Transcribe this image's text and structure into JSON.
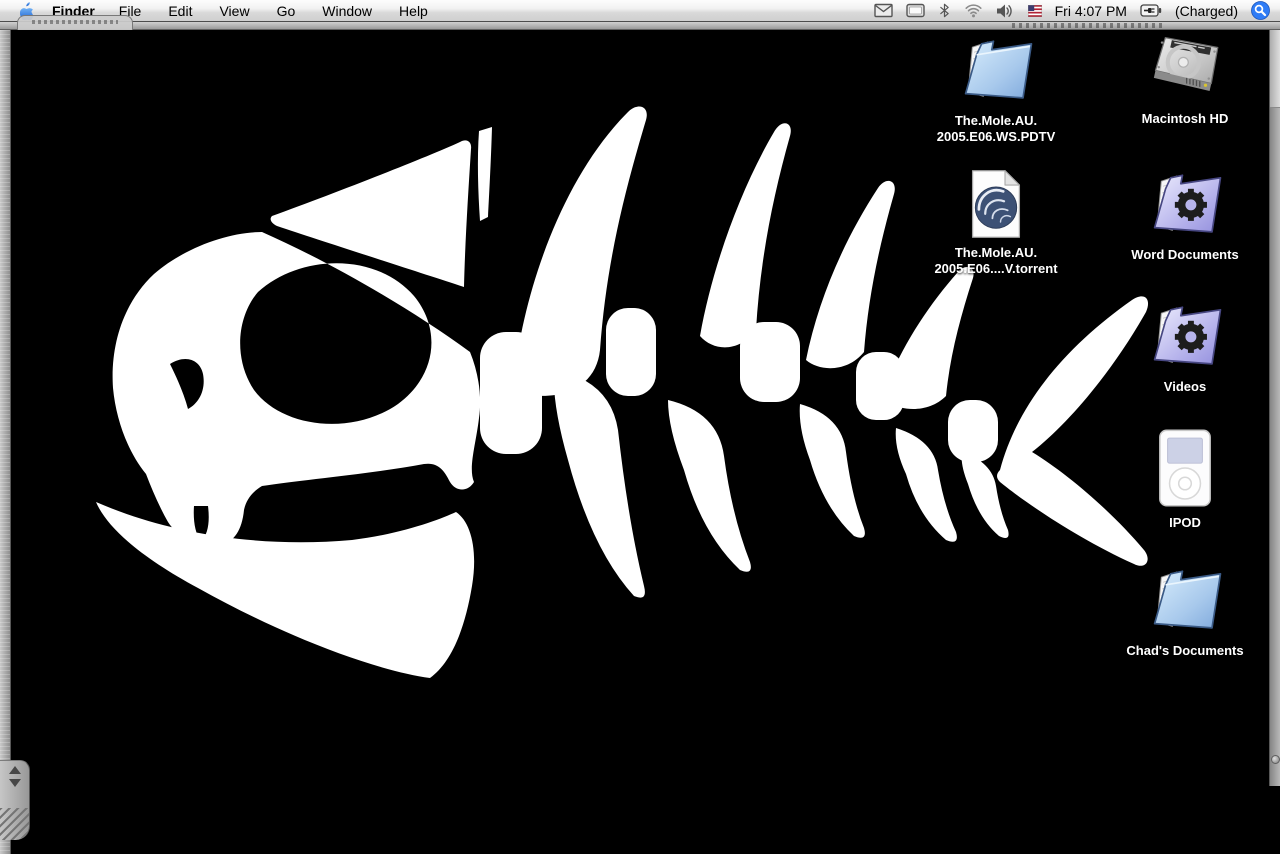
{
  "menu_bar": {
    "app_name": "Finder",
    "menus": [
      "File",
      "Edit",
      "View",
      "Go",
      "Window",
      "Help"
    ],
    "clock": "Fri 4:07 PM",
    "battery_status": "(Charged)",
    "status_icons": [
      "mail-icon",
      "display-icon",
      "bluetooth-icon",
      "wifi-icon",
      "volume-icon",
      "us-flag-icon",
      "battery-icon",
      "spotlight-icon"
    ],
    "colors": {
      "apple_blue": "#2a7ae2",
      "spotlight_blue": "#2f7cf6"
    }
  },
  "desktop": {
    "wallpaper": {
      "description": "white pirate fish skeleton with eye patch on black background",
      "bg_color": "#000000",
      "art_color": "#ffffff"
    },
    "icons": [
      {
        "id": "mole-folder",
        "type": "folder-blue",
        "label_line1": "The.Mole.AU.",
        "label_line2": "2005.E06.WS.PDTV"
      },
      {
        "id": "macintosh-hd",
        "type": "hard-drive",
        "label_line1": "Macintosh HD"
      },
      {
        "id": "mole-torrent",
        "type": "torrent-file",
        "label_line1": "The.Mole.AU.",
        "label_line2": "2005.E06....V.torrent"
      },
      {
        "id": "word-documents",
        "type": "folder-smart",
        "label_line1": "Word Documents"
      },
      {
        "id": "videos",
        "type": "folder-smart",
        "label_line1": "Videos"
      },
      {
        "id": "ipod",
        "type": "ipod",
        "label_line1": "IPOD"
      },
      {
        "id": "chads-documents",
        "type": "folder-blue",
        "label_line1": "Chad's Documents"
      }
    ]
  }
}
